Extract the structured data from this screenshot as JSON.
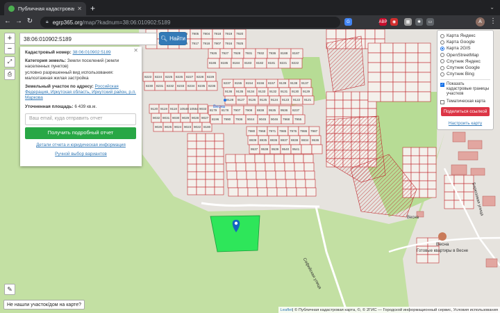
{
  "browser": {
    "tab_title": "Публичная кадастровая карт",
    "tab_close": "✕",
    "new_tab": "+",
    "url_domain": "egrp365.org",
    "url_path": "/map/?kadnum=38:06:010902:5189",
    "extensions": [
      {
        "name": "google-icon",
        "label": "G",
        "color": "#4285f4"
      },
      {
        "name": "adblock-icon",
        "label": "ABP",
        "color": "#c70d2c"
      },
      {
        "name": "extension-red-icon",
        "label": "◉",
        "color": "#d32f2f"
      },
      {
        "name": "extension-grid-icon",
        "label": "▦",
        "color": "#9e9e9e"
      },
      {
        "name": "puzzle-icon",
        "label": "✱",
        "color": "#5f6368"
      },
      {
        "name": "sidebar-icon",
        "label": "▭",
        "color": "#5f6368"
      }
    ],
    "avatar": "A"
  },
  "search": {
    "value": "38:06:010902:5189",
    "button_label": "Найти"
  },
  "info": {
    "cad_label": "Кадастровый номер:",
    "cad_value": "38:06:010902:5189",
    "cat_label": "Категория земель:",
    "cat_value": "Земли поселений (земли населенных пунктов)",
    "use_value": "условно разрешенный вид использования: малоэтажная жилая застройка",
    "addr_label": "Земельный участок по адресу:",
    "addr_value": "Российская Федерация, Иркутская область, Иркутский район, р.п. Маркова",
    "area_label": "Уточненная площадь:",
    "area_value": "6 439 кв.м.",
    "email_placeholder": "Ваш email, куда отправить отчет",
    "get_report": "Получить подробный отчет",
    "details_link": "Детали отчета и юридическая информация",
    "manual_link": "Ручной выбор вариантов"
  },
  "layers": {
    "options": [
      {
        "label": "Карта Яндекс",
        "selected": false
      },
      {
        "label": "Карта Google",
        "selected": false
      },
      {
        "label": "Карта 2GIS",
        "selected": true
      },
      {
        "label": "OpenStreetMap",
        "selected": false
      },
      {
        "label": "Спутник Яндекс",
        "selected": false
      },
      {
        "label": "Спутник Google",
        "selected": false
      },
      {
        "label": "Спутник Bing",
        "selected": false
      }
    ],
    "cadastral_bounds": "Показать кадастровые границы участков",
    "thematic": "Тематическая карта",
    "share": "Поделиться ссылкой",
    "configure": "Настроить карту"
  },
  "map_controls": {
    "zoom_in": "+",
    "zoom_out": "−"
  },
  "not_found": "Не нашли участок/дом на карте?",
  "attribution": {
    "leaflet": "Leaflet",
    "text": " | © Публичная кадастровая карта, ©, © 2ГИС — Городской информационный сервис, Условия использования"
  },
  "map_labels": {
    "village": "Весна",
    "village2": "Готовые квартиры в Весне",
    "street1": "Бирюзовая улица",
    "street2": "Весна",
    "street3": "Софийская улица",
    "poi": "Весна",
    "plots": [
      "7910",
      "7911",
      "7909",
      "7906",
      "7905",
      "7904",
      "7918",
      "7919",
      "7920",
      "7921",
      "7922",
      "7923",
      "7916",
      "7917",
      "7918",
      "7907",
      "7916",
      "7925",
      "7926",
      "7927",
      "7928",
      "7931",
      "7932",
      "7936",
      "8188",
      "8187",
      "8186",
      "8185",
      "8184",
      "8183",
      "8182",
      "8181",
      "8221",
      "8222",
      "8223",
      "8224",
      "8225",
      "8226",
      "8227",
      "8228",
      "8229",
      "8230",
      "8231",
      "8232",
      "8233",
      "8234",
      "8235",
      "8236",
      "8237",
      "8155",
      "8154",
      "8156",
      "8157",
      "9139",
      "9138",
      "9137",
      "9136",
      "9135",
      "9134",
      "9133",
      "9132",
      "9131",
      "9130",
      "9129",
      "9128",
      "9127",
      "9126",
      "9125",
      "9124",
      "9123",
      "9122",
      "9121",
      "9120",
      "9119",
      "9118",
      "10548",
      "10554",
      "9033",
      "9032",
      "9031",
      "9030",
      "9029",
      "9028",
      "9027",
      "9026",
      "9025",
      "9024",
      "9023",
      "9022",
      "8180",
      "8179",
      "8178",
      "7907",
      "7908",
      "8838",
      "9535",
      "9536",
      "8237",
      "8196",
      "7990",
      "7936",
      "9044",
      "9045",
      "9046",
      "7968",
      "7955",
      "7980",
      "7968",
      "7971",
      "7985",
      "7976",
      "7986",
      "7987",
      "8839",
      "8835",
      "8836",
      "8837",
      "8838",
      "8834",
      "9536",
      "9537",
      "9538",
      "9539",
      "9540",
      "9541"
    ]
  }
}
